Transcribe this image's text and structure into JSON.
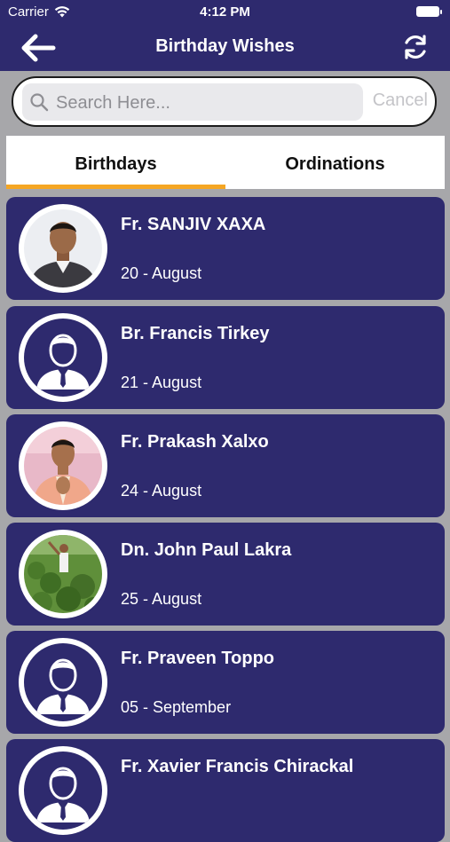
{
  "status": {
    "carrier": "Carrier",
    "time": "4:12 PM"
  },
  "nav": {
    "title": "Birthday Wishes"
  },
  "search": {
    "placeholder": "Search Here...",
    "cancel": "Cancel"
  },
  "tabs": [
    {
      "label": "Birthdays"
    },
    {
      "label": "Ordinations"
    }
  ],
  "people": [
    {
      "name": "Fr. SANJIV XAXA",
      "date": "20 - August",
      "avatar": "photo-portrait"
    },
    {
      "name": "Br. Francis Tirkey",
      "date": "21 - August",
      "avatar": "placeholder-person-icon"
    },
    {
      "name": "Fr. Prakash Xalxo",
      "date": "24 - August",
      "avatar": "photo-portrait"
    },
    {
      "name": "Dn. John Paul Lakra",
      "date": "25 - August",
      "avatar": "photo-outdoor"
    },
    {
      "name": "Fr. Praveen Toppo",
      "date": "05 - September",
      "avatar": "placeholder-person-icon"
    },
    {
      "name": "Fr. Xavier Francis Chirackal",
      "date": "",
      "avatar": "placeholder-person-icon"
    }
  ],
  "colors": {
    "primary": "#2e2a6e",
    "accent": "#f5a623",
    "background": "#a7a7aa"
  }
}
